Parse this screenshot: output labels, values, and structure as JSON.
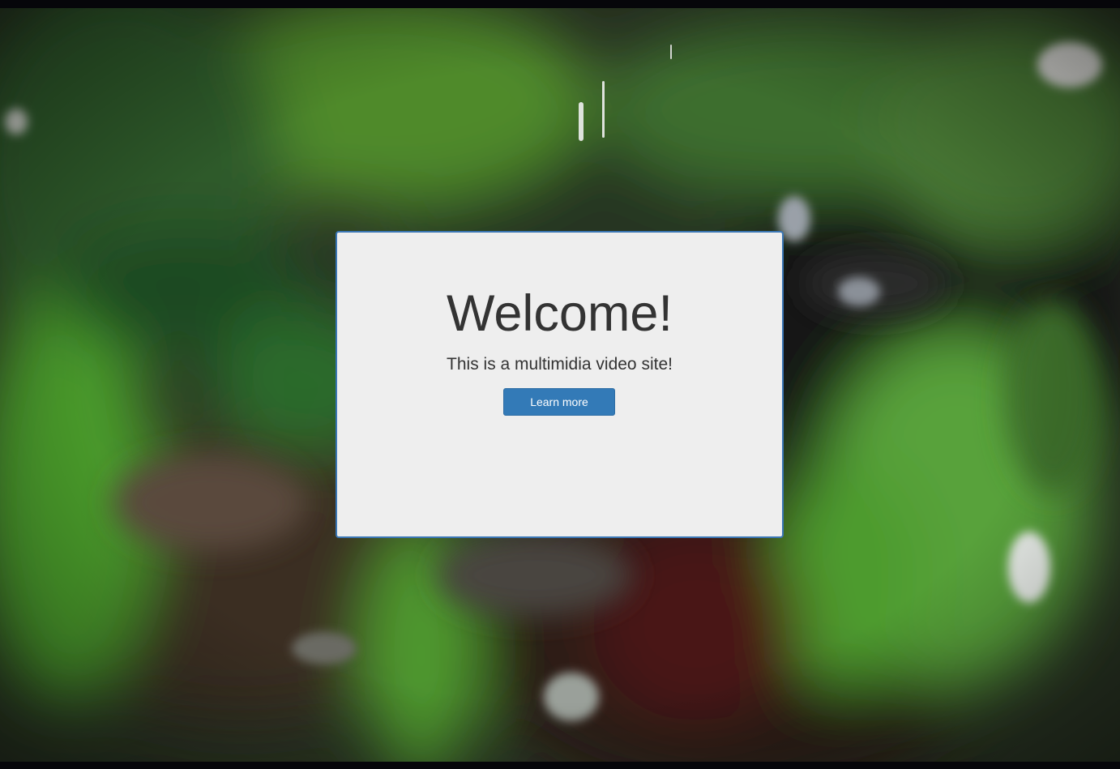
{
  "jumbotron": {
    "heading": "Welcome!",
    "subtitle": "This is a multimidia video site!",
    "button_label": "Learn more"
  },
  "colors": {
    "panel_bg": "#eeeeee",
    "panel_border": "#3a76b5",
    "text": "#333333",
    "button_bg": "#337ab7",
    "button_text": "#ffffff"
  },
  "background": {
    "kind": "video",
    "subject": "blurred green foliage with raindrops"
  }
}
